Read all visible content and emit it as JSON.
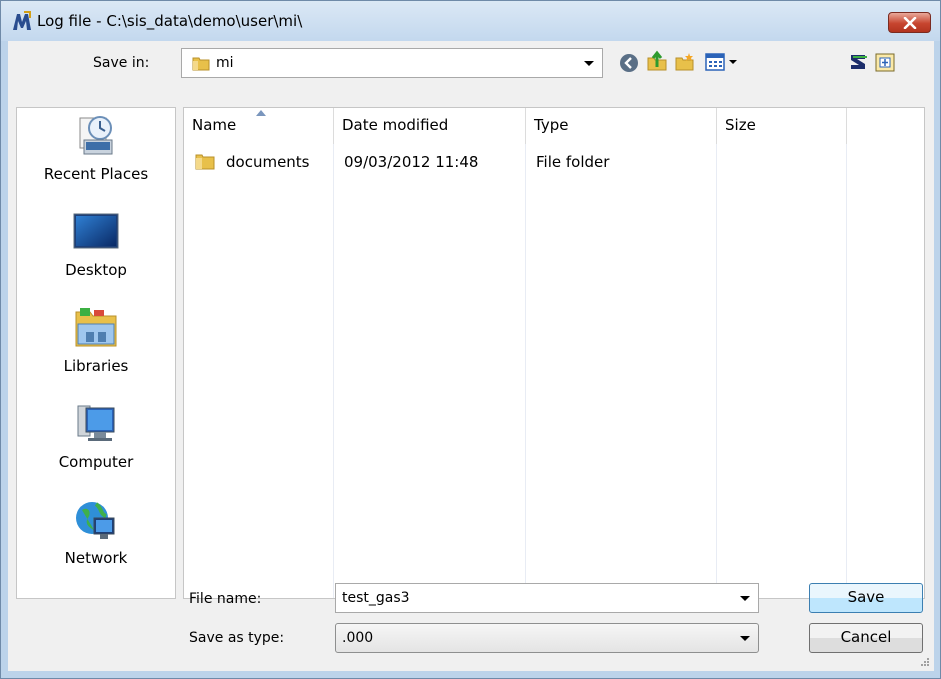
{
  "window": {
    "title": "Log file - C:\\sis_data\\demo\\user\\mi\\"
  },
  "save_in": {
    "label": "Save in:",
    "value": "mi"
  },
  "toolbar": {
    "icons": [
      "back-icon",
      "up-folder-icon",
      "new-folder-icon",
      "view-menu-icon",
      "app-icon-1",
      "app-icon-2"
    ]
  },
  "places": [
    {
      "label": "Recent Places",
      "icon": "recent-places-icon"
    },
    {
      "label": "Desktop",
      "icon": "desktop-icon"
    },
    {
      "label": "Libraries",
      "icon": "libraries-icon"
    },
    {
      "label": "Computer",
      "icon": "computer-icon"
    },
    {
      "label": "Network",
      "icon": "network-icon"
    }
  ],
  "file_list": {
    "columns": [
      "Name",
      "Date modified",
      "Type",
      "Size"
    ],
    "rows": [
      {
        "name": "documents",
        "date": "09/03/2012 11:48",
        "type": "File folder",
        "size": ""
      }
    ]
  },
  "file_name": {
    "label": "File name:",
    "value": "test_gas3"
  },
  "save_as_type": {
    "label": "Save as type:",
    "value": ".000"
  },
  "buttons": {
    "save": "Save",
    "cancel": "Cancel"
  },
  "colors": {
    "titlebar": "#c3d8ee",
    "close_button": "#c7452f",
    "folder": "#e8c04a"
  }
}
